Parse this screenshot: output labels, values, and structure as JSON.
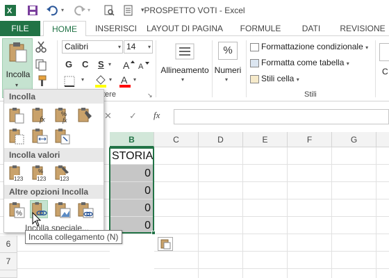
{
  "window": {
    "title": "PROSPETTO VOTI - Excel"
  },
  "qat": {
    "icons": [
      "excel-logo-icon",
      "save-icon",
      "undo-icon",
      "redo-icon",
      "print-preview-icon",
      "customize-qat-icon"
    ]
  },
  "tabs": [
    "FILE",
    "HOME",
    "INSERISCI",
    "LAYOUT DI PAGINA",
    "FORMULE",
    "DATI",
    "REVISIONE"
  ],
  "ribbon": {
    "paste_label": "Incolla",
    "font_name": "Calibri",
    "font_size": "14",
    "font_group_label": "Carattere",
    "font_group_visible": "tere",
    "bold": "G",
    "italic": "C",
    "underline": "S",
    "alignment_label": "Allineamento",
    "number_label": "Numeri",
    "number_symbol": "%",
    "styles": {
      "conditional": "Formattazione condizionale",
      "table": "Formatta come tabella",
      "cell": "Stili cella",
      "group_label": "Stili"
    },
    "accent_color": "#217346",
    "fill_color": "#ffff00",
    "font_color": "#ff0000"
  },
  "formula_bar": {
    "cancel": "✕",
    "confirm": "✓",
    "fx": "fx",
    "value": ""
  },
  "grid": {
    "columns": [
      "B",
      "C",
      "D",
      "E",
      "F",
      "G"
    ],
    "rows": [
      "6",
      "7"
    ],
    "cells_b": [
      "STORIA",
      "0",
      "0",
      "0",
      "0"
    ]
  },
  "paste_menu": {
    "sections": [
      "Incolla",
      "Incolla valori",
      "Altre opzioni Incolla"
    ],
    "paste_icons": [
      "paste-icon",
      "paste-formulas-icon",
      "paste-formulas-number-format-icon",
      "keep-source-format-icon",
      "no-borders-icon",
      "keep-column-widths-icon",
      "transpose-icon"
    ],
    "values_icons": [
      "paste-values-icon",
      "paste-values-number-format-icon",
      "paste-values-source-format-icon"
    ],
    "other_icons": [
      "paste-formatting-icon",
      "paste-link-icon",
      "paste-picture-icon",
      "paste-linked-picture-icon"
    ],
    "tooltip": "Incolla collegamento (N)",
    "hidden_label": "Incolla speciale..."
  }
}
